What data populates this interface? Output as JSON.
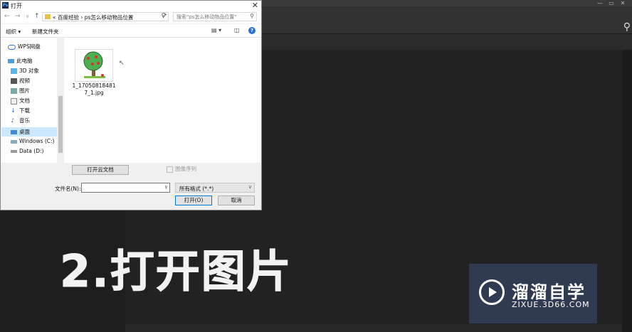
{
  "ps": {
    "win_buttons": [
      "—",
      "▭",
      "✕"
    ],
    "search_icon": "magnifier-icon"
  },
  "overlay": {
    "caption": "2.打开图片"
  },
  "watermark": {
    "title": "溜溜自学",
    "url": "ZIXUE.3D66.COM"
  },
  "dialog": {
    "app_icon_text": "Ps",
    "title": "打开",
    "close": "✕",
    "nav": {
      "back": "←",
      "forward": "→",
      "dropdown": "∨",
      "up": "↑",
      "refresh": "⟳"
    },
    "address": {
      "sep": "«",
      "path": "百度经验 › ps怎么移动物品位置",
      "chevron": "∨"
    },
    "search_placeholder": "搜索\"ps怎么移动物品位置\"",
    "toolbar": {
      "organize": "组织 ▾",
      "new_folder": "新建文件夹"
    },
    "sidebar": {
      "items": [
        {
          "label": "WPS网盘"
        },
        {
          "label": "此电脑"
        },
        {
          "label": "3D 对象"
        },
        {
          "label": "视频"
        },
        {
          "label": "图片"
        },
        {
          "label": "文档"
        },
        {
          "label": "下载"
        },
        {
          "label": "音乐"
        },
        {
          "label": "桌面"
        },
        {
          "label": "Windows (C:)"
        },
        {
          "label": "Data (D:)"
        }
      ]
    },
    "files": [
      {
        "name": "1_170508184817_1.jpg",
        "name_line1": "1_17050818481",
        "name_line2": "7_1.jpg"
      }
    ],
    "buttons": {
      "cloud": "打开云文档",
      "open": "打开(O)",
      "cancel": "取消"
    },
    "image_sequence": "图像序列",
    "filename_label": "文件名(N):",
    "filename_value": "",
    "file_type": "所有格式 (*.*)"
  },
  "colors": {
    "accent": "#0078d7",
    "selection": "#cce8ff",
    "folder": "#e8c14a",
    "help": "#2a6fd6"
  }
}
